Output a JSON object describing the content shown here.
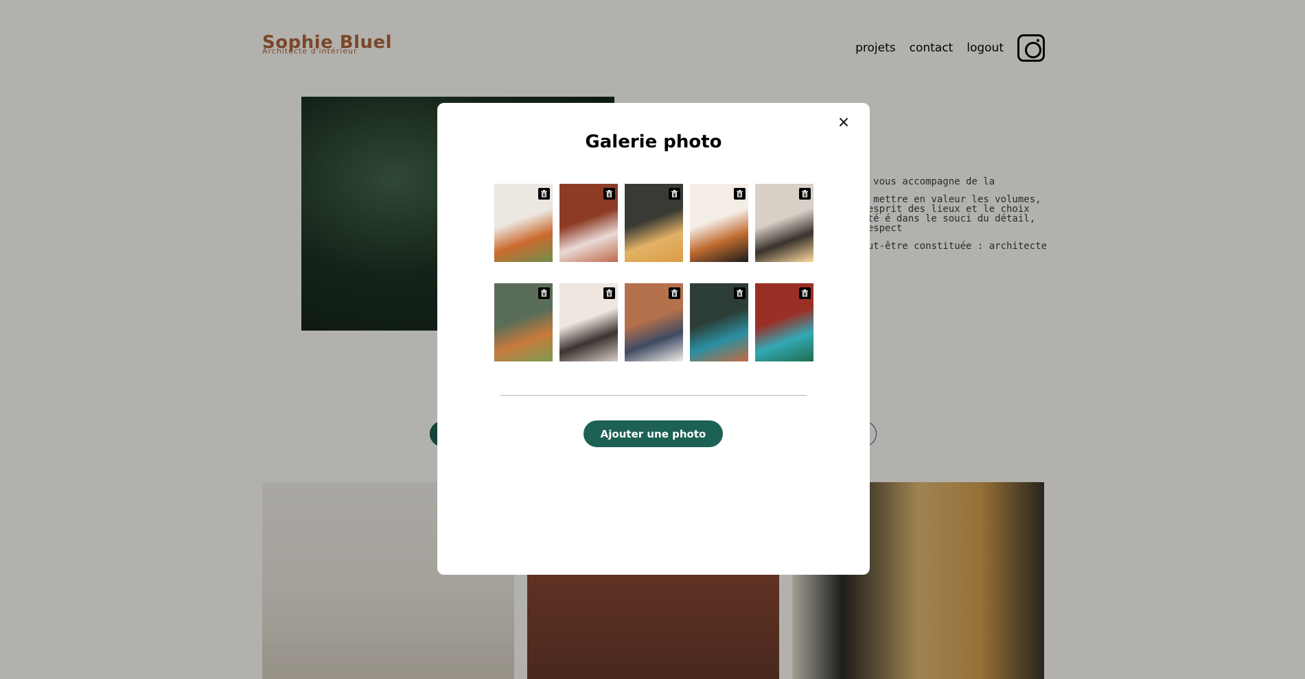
{
  "header": {
    "logo_title": "Sophie Bluel",
    "logo_subtitle": "Architecte d'intérieur",
    "nav": [
      "projets",
      "contact",
      "logout"
    ],
    "instagram_icon": "instagram-icon"
  },
  "intro": {
    "paragraphs": [
      ". Je vous accompagne de la",
      "on à mettre en valeur les volumes, e l'esprit des lieux et le choix adapté é dans le souci du détail, le respect",
      "e peut-être constituée : architecte"
    ]
  },
  "modal": {
    "title": "Galerie photo",
    "close_symbol": "×",
    "add_button": "Ajouter une photo",
    "photos": [
      {
        "name": "photo-1",
        "colors": [
          "#ece7e0",
          "#cc6a2e",
          "#6d8f4d"
        ]
      },
      {
        "name": "photo-2",
        "colors": [
          "#8d3b25",
          "#e9d9d6",
          "#bd6a4a"
        ]
      },
      {
        "name": "photo-3",
        "colors": [
          "#3a3a35",
          "#e3b265",
          "#d99c46"
        ]
      },
      {
        "name": "photo-4",
        "colors": [
          "#f4ede6",
          "#c06b2f",
          "#1c1c1c"
        ]
      },
      {
        "name": "photo-5",
        "colors": [
          "#d8cfc6",
          "#3a332d",
          "#ffdba0"
        ]
      },
      {
        "name": "photo-6",
        "colors": [
          "#5a6d58",
          "#c77a3c",
          "#7e9a52"
        ]
      },
      {
        "name": "photo-7",
        "colors": [
          "#efe6e0",
          "#3a3330",
          "#d8ccc4"
        ]
      },
      {
        "name": "photo-8",
        "colors": [
          "#b5714c",
          "#3f4a63",
          "#f2efea"
        ]
      },
      {
        "name": "photo-9",
        "colors": [
          "#2c3d36",
          "#2b8fa1",
          "#c56a42"
        ]
      },
      {
        "name": "photo-10",
        "colors": [
          "#9a2f26",
          "#33a8b6",
          "#1f6e4d"
        ]
      }
    ],
    "trash_icon": "trash-icon"
  },
  "colors": {
    "accent": "#1d6154",
    "brand": "#b1663c",
    "overlay": "rgba(0,0,0,0.3)"
  }
}
